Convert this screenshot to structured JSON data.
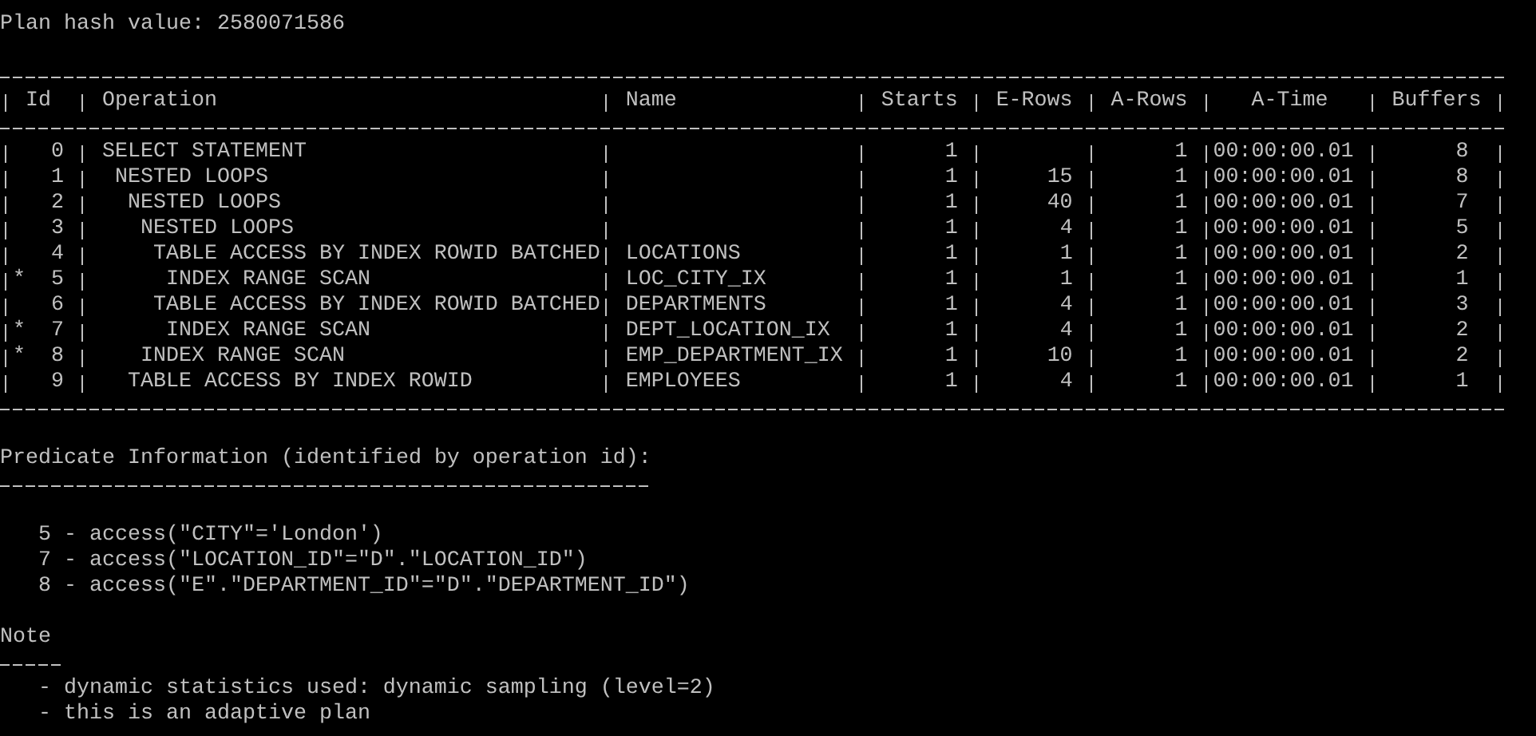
{
  "plan_hash": "Plan hash value: 2580071586",
  "table": {
    "columns": [
      "Id",
      "Operation",
      "Name",
      "Starts",
      "E-Rows",
      "A-Rows",
      "A-Time",
      "Buffers"
    ],
    "rows": [
      {
        "id": "0",
        "operation": "SELECT STATEMENT",
        "starts": "1",
        "a_rows": "1",
        "a_time": "00:00:00.01",
        "buffers": "8",
        "children": [
          {
            "id": "1",
            "operation": "NESTED LOOPS",
            "starts": "1",
            "e_rows": "15",
            "a_rows": "1",
            "a_time": "00:00:00.01",
            "buffers": "8",
            "children": [
              {
                "id": "2",
                "operation": "NESTED LOOPS",
                "starts": "1",
                "e_rows": "40",
                "a_rows": "1",
                "a_time": "00:00:00.01",
                "buffers": "7",
                "children": [
                  {
                    "id": "3",
                    "operation": "NESTED LOOPS",
                    "starts": "1",
                    "e_rows": "4",
                    "a_rows": "1",
                    "a_time": "00:00:00.01",
                    "buffers": "5",
                    "children": [
                      {
                        "id": "4",
                        "operation": "TABLE ACCESS BY INDEX ROWID BATCHED",
                        "name": "LOCATIONS",
                        "starts": "1",
                        "e_rows": "1",
                        "a_rows": "1",
                        "a_time": "00:00:00.01",
                        "buffers": "2",
                        "children": [
                          {
                            "marker": "*",
                            "id": "5",
                            "operation": "INDEX RANGE SCAN",
                            "name": "LOC_CITY_IX",
                            "starts": "1",
                            "e_rows": "1",
                            "a_rows": "1",
                            "a_time": "00:00:00.01",
                            "buffers": "1"
                          }
                        ]
                      },
                      {
                        "id": "6",
                        "operation": "TABLE ACCESS BY INDEX ROWID BATCHED",
                        "name": "DEPARTMENTS",
                        "starts": "1",
                        "e_rows": "4",
                        "a_rows": "1",
                        "a_time": "00:00:00.01",
                        "buffers": "3",
                        "children": [
                          {
                            "marker": "*",
                            "id": "7",
                            "operation": "INDEX RANGE SCAN",
                            "name": "DEPT_LOCATION_IX",
                            "starts": "1",
                            "e_rows": "4",
                            "a_rows": "1",
                            "a_time": "00:00:00.01",
                            "buffers": "2"
                          }
                        ]
                      }
                    ]
                  },
                  {
                    "marker": "*",
                    "id": "8",
                    "operation": "INDEX RANGE SCAN",
                    "name": "EMP_DEPARTMENT_IX",
                    "starts": "1",
                    "e_rows": "10",
                    "a_rows": "1",
                    "a_time": "00:00:00.01",
                    "buffers": "2"
                  }
                ]
              },
              {
                "id": "9",
                "operation": "TABLE ACCESS BY INDEX ROWID",
                "name": "EMPLOYEES",
                "starts": "1",
                "e_rows": "4",
                "a_rows": "1",
                "a_time": "00:00:00.01",
                "buffers": "1"
              }
            ]
          }
        ]
      }
    ]
  },
  "predicates": {
    "heading": "Predicate Information (identified by operation id):",
    "lines": [
      "5 - access(\"CITY\"='London')",
      "7 - access(\"LOCATION_ID\"=\"D\".\"LOCATION_ID\")",
      "8 - access(\"E\".\"DEPARTMENT_ID\"=\"D\".\"DEPARTMENT_ID\")"
    ]
  },
  "note": {
    "heading": "Note",
    "lines": [
      "- dynamic statistics used: dynamic sampling (level=2)",
      "- this is an adaptive plan"
    ]
  }
}
